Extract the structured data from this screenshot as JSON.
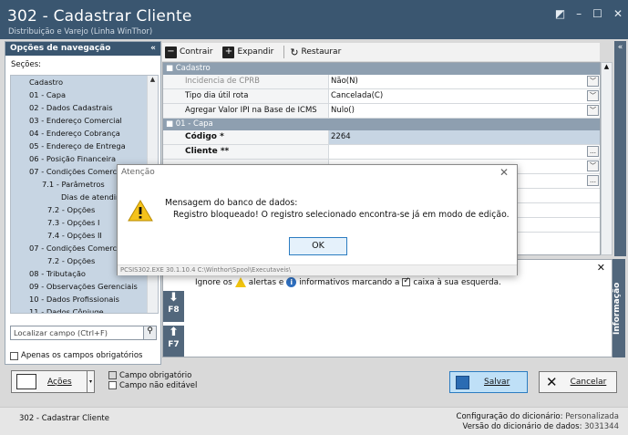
{
  "window": {
    "title": "302 - Cadastrar Cliente",
    "subtitle": "Distribuição e Varejo (Linha WinThor)",
    "controls": [
      "◩",
      "–",
      "☐",
      "✕"
    ]
  },
  "nav": {
    "header": "Opções de navegação",
    "collapse": "«",
    "sections_label": "Seções:",
    "items": [
      "Cadastro",
      "01 - Capa",
      "02 - Dados Cadastrais",
      "03 - Endereço Comercial",
      "04 - Endereço Cobrança",
      "05 - Endereço de Entrega",
      "06 - Posição Financeira",
      "07 - Condições Comerciais",
      "7.1 - Parâmetros",
      "Dias de atendimento",
      "7.2 - Opções",
      "7.3 - Opções I",
      "7.4 - Opções II",
      "07 - Condições Comerciais",
      "7.2 - Opções",
      "08 - Tributação",
      "09 - Observações Gerenciais",
      "10 - Dados Profissionais",
      "11 - Dados Cônjuge"
    ],
    "search_placeholder": "Localizar campo (Ctrl+F)",
    "only_required_label": "Apenas os campos obrigatórios"
  },
  "toolbar": {
    "collapse_label": "Contrair",
    "expand_label": "Expandir",
    "restore_label": "Restaurar"
  },
  "grid": {
    "group1": "Cadastro",
    "rows1": [
      {
        "label": "Incidencia de CPRB",
        "value": "Não(N)"
      },
      {
        "label": "Tipo dia útil rota",
        "value": "Cancelada(C)"
      },
      {
        "label": "Agregar Valor IPI na Base de ICMS",
        "value": "Nulo()"
      }
    ],
    "group2": "01 - Capa",
    "rows2": [
      {
        "label": "Código *",
        "value": "2264"
      },
      {
        "label": "Cliente **",
        "value": ""
      }
    ]
  },
  "info": {
    "text_before": "Ignore os",
    "text_mid1": "alertas e",
    "text_mid2": "informativos marcando a",
    "text_after": "caixa à sua esquerda.",
    "f8": "F8",
    "f7": "F7",
    "close": "✕",
    "side_label": "Informação"
  },
  "bottom": {
    "actions_label": "Ações",
    "legend_required": "Campo obrigatório",
    "legend_noneditable": "Campo não editável",
    "save_label": "Salvar",
    "cancel_label": "Cancelar"
  },
  "status": {
    "left": "302 - Cadastrar Cliente",
    "dict_config_label": "Configuração do dicionário:",
    "dict_config_value": "Personalizada",
    "dict_version_label": "Versão do dicionário de dados:",
    "dict_version_value": "3031344"
  },
  "dialog": {
    "title": "Atenção",
    "line1": "Mensagem do banco de dados:",
    "line2": "Registro bloqueado! O registro selecionado encontra-se já em modo de edição.",
    "ok_label": "OK",
    "footer": "PCSIS302.EXE 30.1.10.4 C:\\Winthor\\Spool\\Executaveis\\"
  },
  "colors": {
    "titlebar": "#3a5670",
    "panel_blue": "#c7d5e3",
    "accent_blue": "#2b7cc1"
  }
}
